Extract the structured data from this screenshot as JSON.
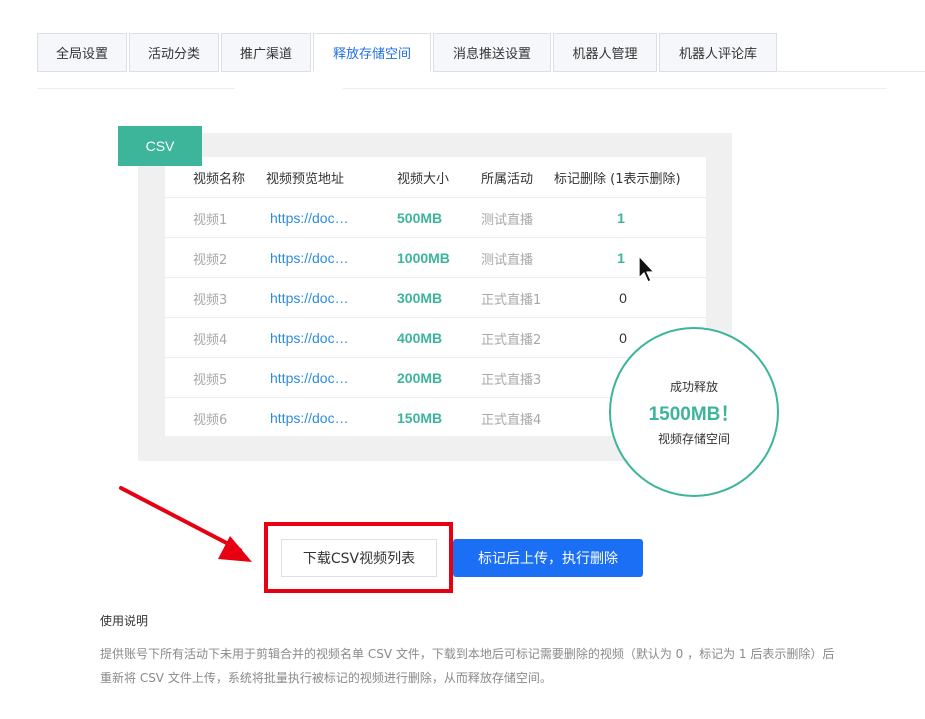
{
  "tabs": [
    {
      "label": "全局设置",
      "active": false
    },
    {
      "label": "活动分类",
      "active": false
    },
    {
      "label": "推广渠道",
      "active": false
    },
    {
      "label": "释放存储空间",
      "active": true
    },
    {
      "label": "消息推送设置",
      "active": false
    },
    {
      "label": "机器人管理",
      "active": false
    },
    {
      "label": "机器人评论库",
      "active": false
    }
  ],
  "illustration": {
    "tag": "CSV",
    "columns": [
      "视频名称",
      "视频预览地址",
      "视频大小",
      "所属活动",
      "标记删除 (1表示删除)"
    ],
    "rows": [
      {
        "name": "视频1",
        "url": "https://doc…",
        "size": "500MB",
        "activity": "测试直播",
        "mark": "1"
      },
      {
        "name": "视频2",
        "url": "https://doc…",
        "size": "1000MB",
        "activity": "测试直播",
        "mark": "1"
      },
      {
        "name": "视频3",
        "url": "https://doc…",
        "size": "300MB",
        "activity": "正式直播1",
        "mark": "0"
      },
      {
        "name": "视频4",
        "url": "https://doc…",
        "size": "400MB",
        "activity": "正式直播2",
        "mark": "0"
      },
      {
        "name": "视频5",
        "url": "https://doc…",
        "size": "200MB",
        "activity": "正式直播3",
        "mark": ""
      },
      {
        "name": "视频6",
        "url": "https://doc…",
        "size": "150MB",
        "activity": "正式直播4",
        "mark": ""
      }
    ],
    "bubble": {
      "line1": "成功释放",
      "line2": "1500MB！",
      "line3": "视频存储空间"
    }
  },
  "actions": {
    "download_label": "下载CSV视频列表",
    "upload_label": "标记后上传，执行删除"
  },
  "usage": {
    "title": "使用说明",
    "text": "提供账号下所有活动下未用于剪辑合并的视频名单 CSV 文件，下载到本地后可标记需要删除的视频（默认为 0 ，标记为 1 后表示删除）后重新将 CSV 文件上传，系统将批量执行被标记的视频进行删除，从而释放存储空间。"
  },
  "colors": {
    "accent": "#3cb59b",
    "primary": "#1a6ff5",
    "highlight": "#e60012",
    "link": "#2c8be0"
  }
}
